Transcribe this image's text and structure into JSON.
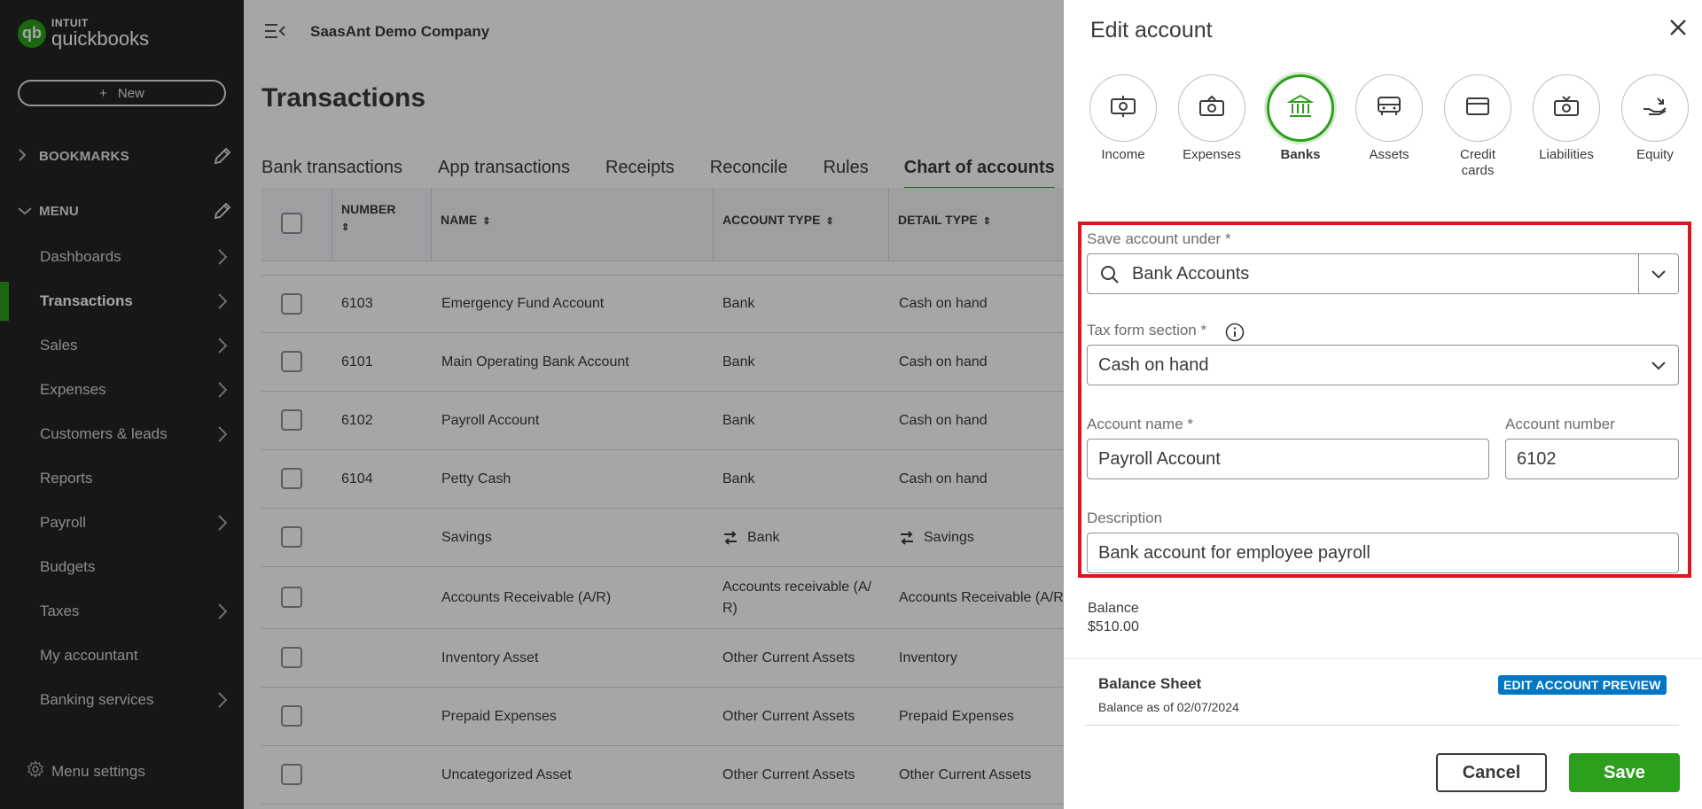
{
  "sidebar": {
    "logo": {
      "brand_top": "INTUIT",
      "brand_bottom": "quickbooks",
      "mark": "qb"
    },
    "new_button": {
      "plus": "+",
      "label": "New"
    },
    "bookmarks_label": "BOOKMARKS",
    "menu_label": "MENU",
    "items": [
      {
        "label": "Dashboards",
        "arrow": true
      },
      {
        "label": "Transactions",
        "arrow": true,
        "active": true
      },
      {
        "label": "Sales",
        "arrow": true
      },
      {
        "label": "Expenses",
        "arrow": true
      },
      {
        "label": "Customers & leads",
        "arrow": true
      },
      {
        "label": "Reports",
        "arrow": false
      },
      {
        "label": "Payroll",
        "arrow": true
      },
      {
        "label": "Budgets",
        "arrow": false
      },
      {
        "label": "Taxes",
        "arrow": true
      },
      {
        "label": "My accountant",
        "arrow": false
      },
      {
        "label": "Banking services",
        "arrow": true
      }
    ],
    "menu_settings": "Menu settings"
  },
  "header": {
    "company": "SaasAnt Demo Company",
    "page_title": "Transactions"
  },
  "tabs": [
    {
      "label": "Bank transactions"
    },
    {
      "label": "App transactions"
    },
    {
      "label": "Receipts"
    },
    {
      "label": "Reconcile"
    },
    {
      "label": "Rules"
    },
    {
      "label": "Chart of accounts",
      "active": true
    }
  ],
  "table": {
    "columns": {
      "number": "NUMBER",
      "name": "NAME",
      "account_type": "ACCOUNT TYPE",
      "detail_type": "DETAIL TYPE"
    },
    "rows": [
      {
        "number": "6103",
        "name": "Emergency Fund Account",
        "type": "Bank",
        "detail": "Cash on hand"
      },
      {
        "number": "6101",
        "name": "Main Operating Bank Account",
        "type": "Bank",
        "detail": "Cash on hand"
      },
      {
        "number": "6102",
        "name": "Payroll Account",
        "type": "Bank",
        "detail": "Cash on hand"
      },
      {
        "number": "6104",
        "name": "Petty Cash",
        "type": "Bank",
        "detail": "Cash on hand"
      },
      {
        "number": "",
        "name": "Savings",
        "type": "Bank",
        "detail": "Savings"
      },
      {
        "number": "",
        "name": "Accounts Receivable (A/R)",
        "type_line1": "Accounts receivable (A/",
        "type_line2": "R)",
        "detail": "Accounts Receivable (A/R"
      },
      {
        "number": "",
        "name": "Inventory Asset",
        "type": "Other Current Assets",
        "detail": "Inventory"
      },
      {
        "number": "",
        "name": "Prepaid Expenses",
        "type": "Other Current Assets",
        "detail": "Prepaid Expenses"
      },
      {
        "number": "",
        "name": "Uncategorized Asset",
        "type": "Other Current Assets",
        "detail": "Other Current Assets"
      }
    ]
  },
  "drawer": {
    "title": "Edit account",
    "account_types": [
      {
        "label": "Income",
        "icon": "income-icon"
      },
      {
        "label": "Expenses",
        "icon": "expenses-icon"
      },
      {
        "label": "Banks",
        "icon": "bank-icon",
        "active": true
      },
      {
        "label": "Assets",
        "icon": "assets-icon"
      },
      {
        "label_line1": "Credit",
        "label_line2": "cards",
        "icon": "credit-card-icon"
      },
      {
        "label": "Liabilities",
        "icon": "liabilities-icon"
      },
      {
        "label": "Equity",
        "icon": "equity-icon"
      }
    ],
    "save_under": {
      "label": "Save account under *",
      "value": "Bank Accounts"
    },
    "tax_form": {
      "label": "Tax form section *",
      "value": "Cash on hand"
    },
    "account_name": {
      "label": "Account name *",
      "value": "Payroll Account"
    },
    "account_number": {
      "label": "Account number",
      "value": "6102"
    },
    "description": {
      "label": "Description",
      "value": "Bank account for employee payroll"
    },
    "balance": {
      "label": "Balance",
      "value": "$510.00"
    },
    "balance_sheet": {
      "title": "Balance Sheet",
      "subtitle": "Balance as of 02/07/2024",
      "badge": "EDIT ACCOUNT PREVIEW"
    },
    "cancel_label": "Cancel",
    "save_label": "Save"
  },
  "colors": {
    "brand_green": "#2ca01c",
    "sidebar_bg": "#242424",
    "highlight_red": "#e0141e",
    "badge_blue": "#0077c5"
  }
}
